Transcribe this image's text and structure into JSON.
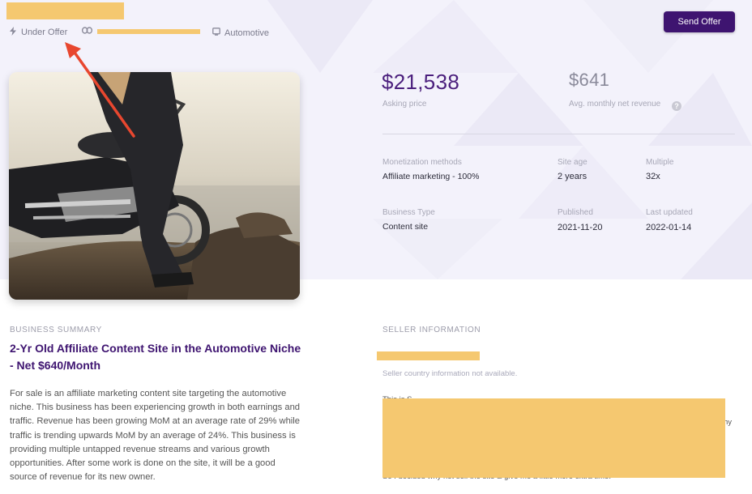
{
  "header": {
    "status_label": "Under Offer",
    "category_label": "Automotive",
    "send_offer_label": "Send Offer"
  },
  "stats": {
    "asking_price_value": "$21,538",
    "asking_price_label": "Asking price",
    "net_revenue_value": "$641",
    "net_revenue_label": "Avg. monthly net revenue",
    "help_glyph": "?"
  },
  "details": {
    "monetization_label": "Monetization methods",
    "monetization_value": "Affiliate marketing - 100%",
    "site_age_label": "Site age",
    "site_age_value": "2 years",
    "multiple_label": "Multiple",
    "multiple_value": "32x",
    "business_type_label": "Business Type",
    "business_type_value": "Content site",
    "published_label": "Published",
    "published_value": "2021-11-20",
    "last_updated_label": "Last updated",
    "last_updated_value": "2022-01-14"
  },
  "summary": {
    "section_label": "BUSINESS SUMMARY",
    "title": "2-Yr Old Affiliate Content Site in the Automotive Niche - Net $640/Month",
    "body": "For sale is an affiliate marketing content site targeting the automotive niche. This business has been experiencing growth in both earnings and traffic. Revenue has been growing MoM at an average rate of 29% while traffic is trending upwards MoM by an average of 24%. This business is providing multiple untapped revenue streams and various growth opportunities. After some work is done on the site, it will be a good source of revenue for its new owner."
  },
  "seller": {
    "section_label": "SELLER INFORMATION",
    "country_note": "Seller country information not available.",
    "partial_text_1": "This is S",
    "partial_text_2": "hy",
    "partial_text_3": "So I decided why not sell the site & give me a little more extra time."
  },
  "colors": {
    "brand_purple": "#3e1470",
    "price_purple": "#4b1f7d",
    "redaction_yellow": "#f5c870",
    "annotation_red": "#e8472f"
  },
  "icons": {
    "status": "bolt-icon",
    "link": "link-icon",
    "category": "monitor-icon",
    "help": "question-circle-icon"
  }
}
